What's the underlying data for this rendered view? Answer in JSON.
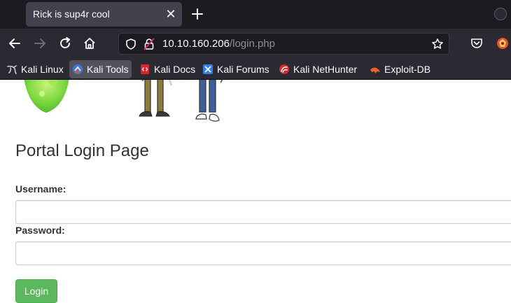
{
  "browser": {
    "tab": {
      "title": "Rick is sup4r cool",
      "close_glyph": "✕"
    },
    "url": {
      "host": "10.10.160.206",
      "path": "/login.php"
    },
    "bookmarks": [
      {
        "label": "Kali Linux",
        "icon": "kali-dragon-icon"
      },
      {
        "label": "Kali Tools",
        "icon": "kali-tools-icon",
        "active": true
      },
      {
        "label": "Kali Docs",
        "icon": "kali-docs-icon"
      },
      {
        "label": "Kali Forums",
        "icon": "kali-forums-icon"
      },
      {
        "label": "Kali NetHunter",
        "icon": "kali-nethunter-icon"
      },
      {
        "label": "Exploit-DB",
        "icon": "exploit-db-icon"
      }
    ]
  },
  "page": {
    "title": "Portal Login Page",
    "username_label": "Username:",
    "password_label": "Password:",
    "username_value": "",
    "password_value": "",
    "login_button": "Login"
  },
  "colors": {
    "chrome_dark": "#1c1b22",
    "chrome": "#2b2a33",
    "login_green": "#5cb85c"
  }
}
